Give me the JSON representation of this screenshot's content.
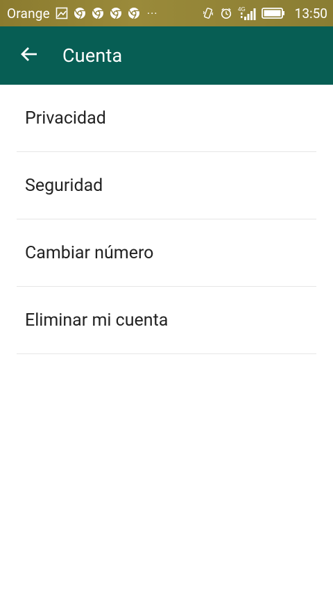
{
  "status_bar": {
    "carrier": "Orange",
    "dots": "···",
    "network": "4G",
    "time": "13:50",
    "icons": [
      "image-icon",
      "chrome-icon",
      "chrome-icon",
      "chrome-icon",
      "chrome-icon",
      "vibrate-icon",
      "alarm-icon",
      "signal-icon",
      "battery-icon"
    ]
  },
  "app_bar": {
    "title": "Cuenta",
    "back_icon": "arrow-left-icon",
    "color": "#075e54"
  },
  "menu": {
    "items": [
      {
        "label": "Privacidad"
      },
      {
        "label": "Seguridad"
      },
      {
        "label": "Cambiar número"
      },
      {
        "label": "Eliminar mi cuenta"
      }
    ]
  }
}
